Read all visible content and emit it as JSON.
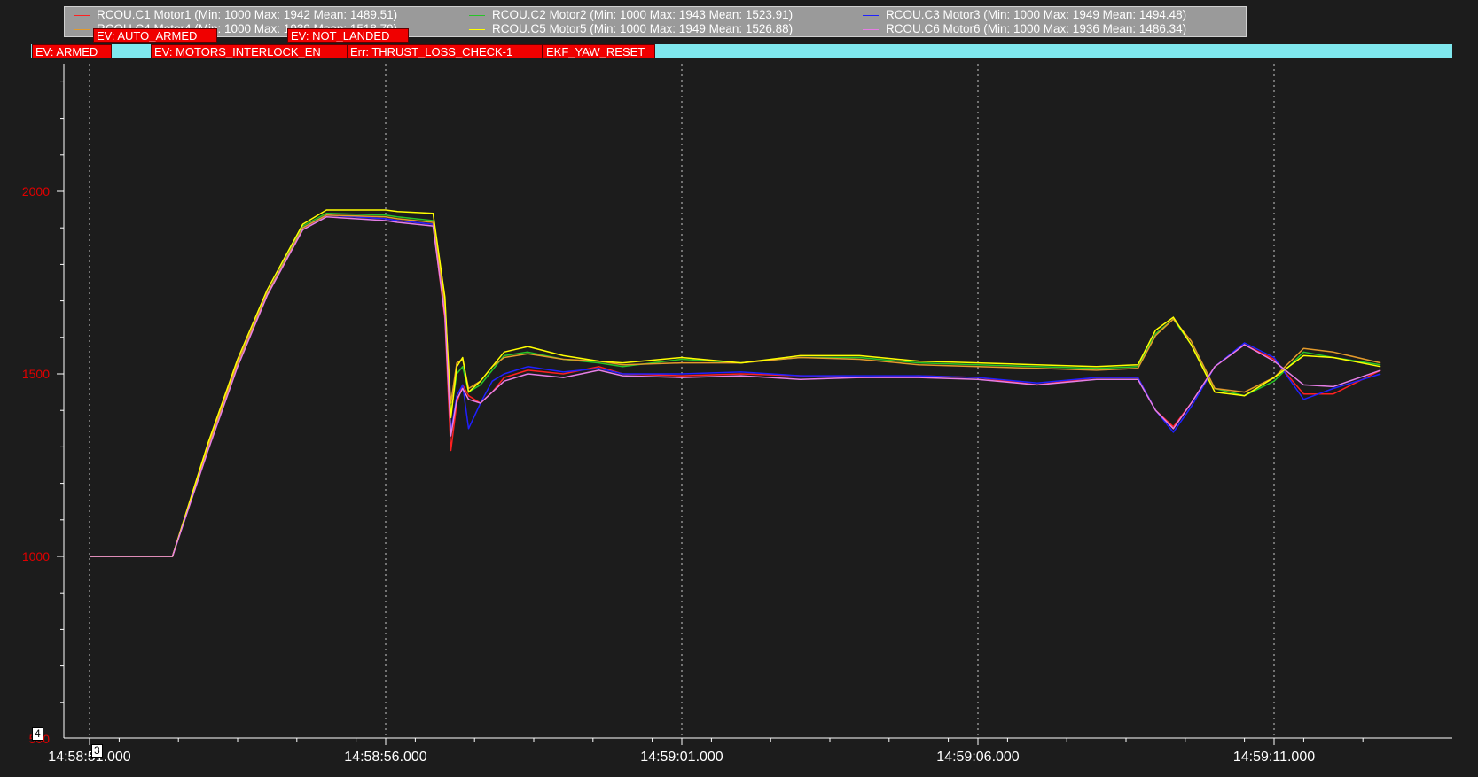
{
  "chart_data": {
    "type": "line",
    "title": "",
    "xlabel": "",
    "ylabel": "",
    "ylim": [
      500,
      2400
    ],
    "xlim_seconds": [
      0,
      21.8
    ],
    "x_unit": "seconds after 14:58:51.000",
    "y_ticks": [
      "2000",
      "1500",
      "1000",
      "500"
    ],
    "x_ticks": [
      "14:58:51.000",
      "14:58:56.000",
      "14:59:01.000",
      "14:59:06.000",
      "14:59:11.000"
    ],
    "grid": "vertical dotted at major x ticks",
    "legend_placement": "top",
    "series": [
      {
        "name": "RCOU.C1 Motor1 (Min: 1000 Max: 1942 Mean: 1489.51)",
        "color": "#ff2020",
        "x": [
          0,
          1.4,
          2,
          2.5,
          3,
          3.6,
          4,
          5,
          5.2,
          5.8,
          6.0,
          6.1,
          6.2,
          6.3,
          6.4,
          6.6,
          6.8,
          7.0,
          7.4,
          8,
          8.6,
          9,
          10,
          11,
          12,
          13,
          14,
          15,
          16,
          17,
          17.7,
          18,
          18.3,
          18.6,
          19,
          19.5,
          20,
          20.5,
          21,
          21.8
        ],
        "y": [
          1000,
          1000,
          1300,
          1530,
          1720,
          1900,
          1935,
          1925,
          1920,
          1910,
          1650,
          1290,
          1420,
          1470,
          1440,
          1420,
          1450,
          1490,
          1510,
          1500,
          1520,
          1500,
          1495,
          1500,
          1495,
          1490,
          1495,
          1490,
          1470,
          1490,
          1490,
          1400,
          1355,
          1420,
          1520,
          1580,
          1540,
          1445,
          1445,
          1510
        ]
      },
      {
        "name": "RCOU.C2 Motor2 (Min: 1000 Max: 1943 Mean: 1523.91)",
        "color": "#27c427",
        "x": [
          0,
          1.4,
          2,
          2.5,
          3,
          3.6,
          4,
          5,
          5.2,
          5.8,
          6.0,
          6.1,
          6.2,
          6.3,
          6.4,
          6.6,
          6.8,
          7.0,
          7.4,
          8,
          8.6,
          9,
          10,
          11,
          12,
          13,
          14,
          15,
          16,
          17,
          17.7,
          18,
          18.3,
          18.6,
          19,
          19.5,
          20,
          20.5,
          21,
          21.8
        ],
        "y": [
          1000,
          1000,
          1300,
          1530,
          1720,
          1905,
          1940,
          1935,
          1930,
          1920,
          1700,
          1390,
          1500,
          1520,
          1450,
          1470,
          1510,
          1550,
          1560,
          1540,
          1530,
          1520,
          1540,
          1530,
          1545,
          1545,
          1530,
          1525,
          1520,
          1515,
          1520,
          1610,
          1650,
          1580,
          1460,
          1440,
          1480,
          1560,
          1545,
          1525
        ]
      },
      {
        "name": "RCOU.C3 Motor3 (Min: 1000 Max: 1949 Mean: 1494.48)",
        "color": "#2020ff",
        "x": [
          0,
          1.4,
          2,
          2.5,
          3,
          3.6,
          4,
          5,
          5.2,
          5.8,
          6.0,
          6.1,
          6.2,
          6.3,
          6.4,
          6.6,
          6.8,
          7.0,
          7.4,
          8,
          8.6,
          9,
          10,
          11,
          12,
          13,
          14,
          15,
          16,
          17,
          17.7,
          18,
          18.3,
          18.6,
          19,
          19.5,
          20,
          20.5,
          21,
          21.8
        ],
        "y": [
          1000,
          1000,
          1300,
          1530,
          1720,
          1900,
          1935,
          1925,
          1920,
          1910,
          1670,
          1340,
          1440,
          1470,
          1350,
          1420,
          1480,
          1500,
          1520,
          1505,
          1515,
          1500,
          1500,
          1505,
          1495,
          1495,
          1495,
          1490,
          1475,
          1490,
          1490,
          1400,
          1340,
          1410,
          1520,
          1585,
          1545,
          1430,
          1460,
          1500
        ]
      },
      {
        "name": "RCOU.C4 Motor4 (Min: 1000 Max: 1939 Mean: 1518.79)",
        "color": "#e39a2a",
        "x": [
          0,
          1.4,
          2,
          2.5,
          3,
          3.6,
          4,
          5,
          5.2,
          5.8,
          6.0,
          6.1,
          6.2,
          6.3,
          6.4,
          6.6,
          6.8,
          7.0,
          7.4,
          8,
          8.6,
          9,
          10,
          11,
          12,
          13,
          14,
          15,
          16,
          17,
          17.7,
          18,
          18.3,
          18.6,
          19,
          19.5,
          20,
          20.5,
          21,
          21.8
        ],
        "y": [
          1000,
          1000,
          1300,
          1530,
          1720,
          1900,
          1935,
          1930,
          1925,
          1915,
          1690,
          1420,
          1530,
          1540,
          1460,
          1480,
          1520,
          1545,
          1555,
          1540,
          1535,
          1525,
          1530,
          1530,
          1545,
          1540,
          1525,
          1520,
          1515,
          1510,
          1515,
          1605,
          1650,
          1590,
          1460,
          1450,
          1490,
          1570,
          1560,
          1530
        ]
      },
      {
        "name": "RCOU.C5 Motor5 (Min: 1000 Max: 1949 Mean: 1526.88)",
        "color": "#ffff00",
        "x": [
          0,
          1.4,
          2,
          2.5,
          3,
          3.6,
          4,
          5,
          5.2,
          5.8,
          6.0,
          6.1,
          6.2,
          6.3,
          6.4,
          6.6,
          6.8,
          7.0,
          7.4,
          8,
          8.6,
          9,
          10,
          11,
          12,
          13,
          14,
          15,
          16,
          17,
          17.7,
          18,
          18.3,
          18.6,
          19,
          19.5,
          20,
          20.5,
          21,
          21.8
        ],
        "y": [
          1000,
          1000,
          1310,
          1540,
          1730,
          1910,
          1949,
          1949,
          1945,
          1940,
          1710,
          1380,
          1520,
          1545,
          1450,
          1480,
          1520,
          1560,
          1575,
          1550,
          1535,
          1530,
          1545,
          1530,
          1550,
          1550,
          1535,
          1530,
          1525,
          1520,
          1525,
          1620,
          1655,
          1580,
          1450,
          1440,
          1490,
          1550,
          1545,
          1520
        ]
      },
      {
        "name": "RCOU.C6 Motor6 (Min: 1000 Max: 1936 Mean: 1486.34)",
        "color": "#e57ee5",
        "x": [
          0,
          1.4,
          2,
          2.5,
          3,
          3.6,
          4,
          5,
          5.2,
          5.8,
          6.0,
          6.1,
          6.2,
          6.3,
          6.4,
          6.6,
          6.8,
          7.0,
          7.4,
          8,
          8.6,
          9,
          10,
          11,
          12,
          13,
          14,
          15,
          16,
          17,
          17.7,
          18,
          18.3,
          18.6,
          19,
          19.5,
          20,
          20.5,
          21,
          21.8
        ],
        "y": [
          1000,
          1000,
          1290,
          1520,
          1715,
          1895,
          1930,
          1920,
          1915,
          1905,
          1660,
          1330,
          1430,
          1460,
          1430,
          1420,
          1450,
          1480,
          1500,
          1490,
          1510,
          1495,
          1490,
          1495,
          1485,
          1490,
          1490,
          1485,
          1470,
          1485,
          1485,
          1400,
          1350,
          1420,
          1520,
          1580,
          1535,
          1470,
          1465,
          1510
        ]
      }
    ]
  },
  "legend": {
    "items": [
      {
        "label": "RCOU.C1 Motor1 (Min: 1000 Max: 1942 Mean: 1489.51)",
        "color": "#ff2020"
      },
      {
        "label": "RCOU.C2 Motor2 (Min: 1000 Max: 1943 Mean: 1523.91)",
        "color": "#27c427"
      },
      {
        "label": "RCOU.C3 Motor3 (Min: 1000 Max: 1949 Mean: 1494.48)",
        "color": "#2020ff"
      },
      {
        "label": "RCOU.C4 Motor4 (Min: 1000 Max: 1939 Mean: 1518.79)",
        "color": "#e39a2a"
      },
      {
        "label": "RCOU.C5 Motor5 (Min: 1000 Max: 1949 Mean: 1526.88)",
        "color": "#ffff00"
      },
      {
        "label": "RCOU.C6 Motor6 (Min: 1000 Max: 1936 Mean: 1486.34)",
        "color": "#e57ee5"
      }
    ]
  },
  "events": {
    "armed": "EV: ARMED",
    "auto_armed": "EV: AUTO_ARMED",
    "motors_interlock": "EV: MOTORS_INTERLOCK_EN",
    "not_landed": "EV: NOT_LANDED",
    "thrust_loss": "Err: THRUST_LOSS_CHECK-1",
    "ekf_yaw_reset": "EKF_YAW_RESET"
  },
  "markers": {
    "m3": "3",
    "m4": "4"
  },
  "colors": {
    "background": "#1c1c1c",
    "axis": "#ffffff",
    "y_tick_label": "#e00000",
    "x_tick_label": "#ffffff",
    "event_strip": "#7fe8ee",
    "event_tag": "#f00000"
  }
}
